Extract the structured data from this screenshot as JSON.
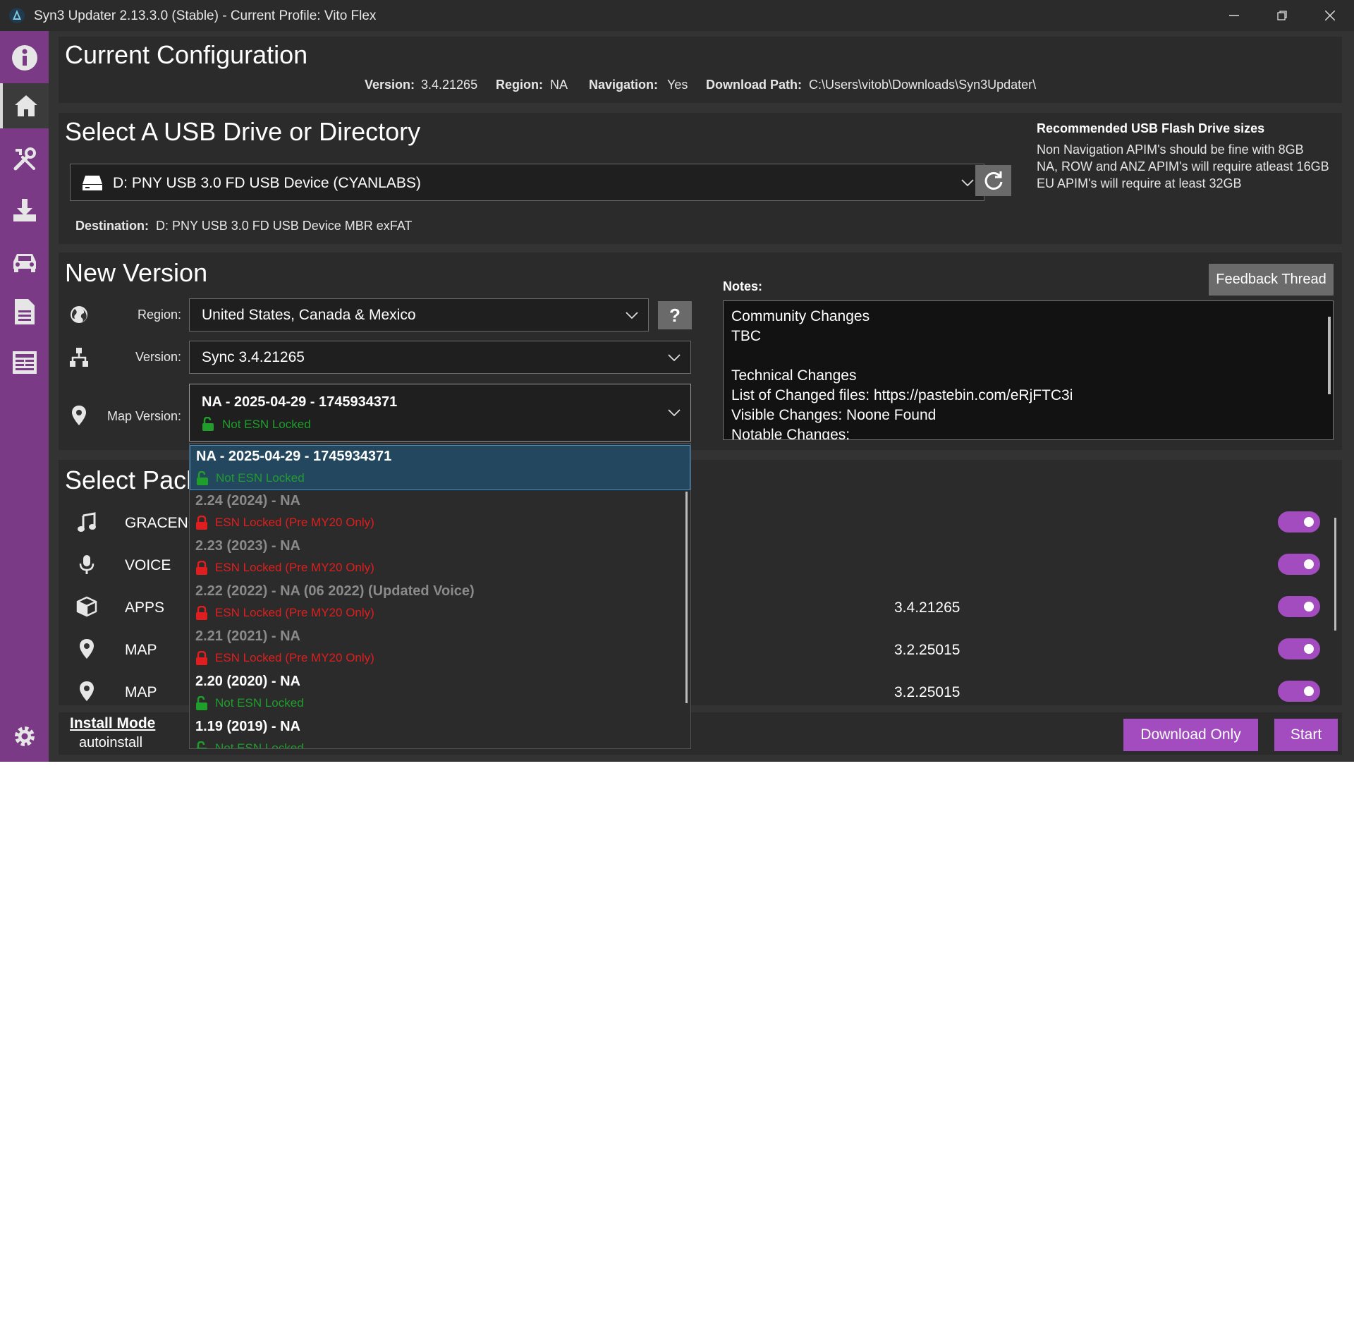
{
  "window": {
    "title": "Syn3 Updater 2.13.3.0 (Stable) - Current Profile: Vito Flex"
  },
  "current_config": {
    "heading": "Current Configuration",
    "version_label": "Version:",
    "version_value": "3.4.21265",
    "region_label": "Region:",
    "region_value": "NA",
    "navigation_label": "Navigation:",
    "navigation_value": "Yes",
    "download_path_label": "Download Path:",
    "download_path_value": "C:\\Users\\vitob\\Downloads\\Syn3Updater\\"
  },
  "usb": {
    "heading": "Select A USB Drive or Directory",
    "selected_drive": "D: PNY USB 3.0 FD USB Device (CYANLABS)",
    "destination_label": "Destination:",
    "destination_value": "D: PNY USB 3.0 FD USB Device  MBR exFAT",
    "recommend_title": "Recommended USB Flash Drive sizes",
    "recommend_lines": [
      "Non Navigation APIM's should be fine with 8GB",
      "NA, ROW and ANZ APIM's will require atleast 16GB",
      "EU APIM's will require at least 32GB"
    ]
  },
  "new_version": {
    "heading": "New Version",
    "region_label": "Region:",
    "region_value": "United States, Canada & Mexico",
    "help_label": "?",
    "version_label": "Version:",
    "version_value": "Sync 3.4.21265",
    "map_label": "Map Version:",
    "map_value_title": "NA - 2025-04-29 - 1745934371",
    "map_value_sub": "Not ESN Locked",
    "notes_label": "Notes:",
    "feedback_button": "Feedback Thread",
    "notes_lines": [
      "Community Changes",
      "TBC",
      "",
      "Technical Changes",
      "List of Changed files: https://pastebin.com/eRjFTC3i",
      "Visible Changes: Noone Found",
      "Notable Changes:"
    ]
  },
  "map_dropdown": {
    "items": [
      {
        "title": "NA - 2025-04-29 - 1745934371",
        "sub": "Not ESN Locked",
        "locked": false,
        "selected": true
      },
      {
        "title": "2.24 (2024) - NA",
        "sub": "ESN Locked (Pre MY20 Only)",
        "locked": true,
        "selected": false
      },
      {
        "title": "2.23 (2023) - NA",
        "sub": "ESN Locked (Pre MY20 Only)",
        "locked": true,
        "selected": false
      },
      {
        "title": "2.22 (2022) - NA (06 2022) (Updated Voice)",
        "sub": "ESN Locked (Pre MY20 Only)",
        "locked": true,
        "selected": false
      },
      {
        "title": "2.21 (2021) - NA",
        "sub": "ESN Locked (Pre MY20 Only)",
        "locked": true,
        "selected": false
      },
      {
        "title": "2.20 (2020) - NA",
        "sub": "Not ESN Locked",
        "locked": false,
        "selected": false
      },
      {
        "title": "1.19 (2019) - NA",
        "sub": "Not ESN Locked",
        "locked": false,
        "selected": false
      }
    ]
  },
  "packages": {
    "heading": "Select Packages",
    "rows": [
      {
        "name": "GRACENOTES",
        "version": "",
        "enabled": true
      },
      {
        "name": "VOICE",
        "version": "",
        "enabled": true
      },
      {
        "name": "APPS",
        "version": "3.4.21265",
        "enabled": true
      },
      {
        "name": "MAP",
        "version": "3.2.25015",
        "enabled": true
      },
      {
        "name": "MAP",
        "version": "3.2.25015",
        "enabled": true
      }
    ]
  },
  "footer": {
    "install_mode_label": "Install Mode",
    "install_mode_value": "autoinstall",
    "download_only_button": "Download Only",
    "start_button": "Start"
  },
  "colors": {
    "accent": "#a24cc0",
    "sidebar": "#7a3a86",
    "esn_locked": "#e01e1e",
    "not_esn_locked": "#1f9e2c"
  }
}
